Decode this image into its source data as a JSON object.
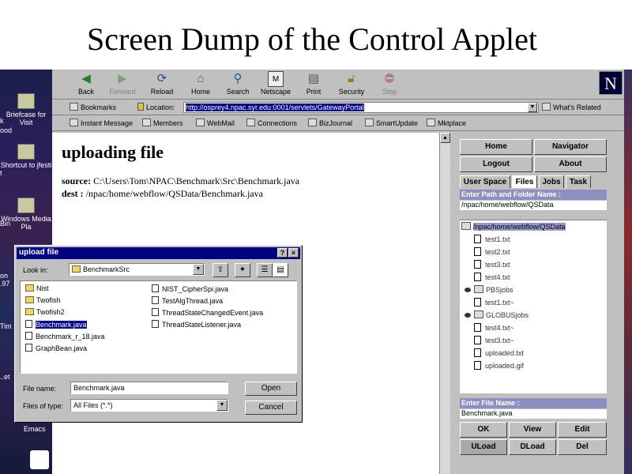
{
  "slide_title": "Screen Dump of the Control Applet",
  "desktop": {
    "icons": [
      "Briefcase for Visit",
      "Shortcut to jfesti",
      "Windows Media Pla",
      "Emacs"
    ],
    "partial_left": [
      "Bin",
      "k",
      "ood",
      "t",
      "on",
      ".97",
      "Tim",
      "..et",
      "Emacs"
    ]
  },
  "toolbar": {
    "back": "Back",
    "forward": "Forward",
    "reload": "Reload",
    "home": "Home",
    "search": "Search",
    "netscape": "Netscape",
    "print": "Print",
    "security": "Security",
    "stop": "Stop"
  },
  "location": {
    "bookmarks": "Bookmarks",
    "label": "Location:",
    "url": "http://osprey4.npac.syr.edu:0001/servlets/GatewayPortal",
    "whats_related": "What's Related"
  },
  "personal": [
    "Instant Message",
    "Members",
    "WebMail",
    "Connections",
    "BizJournal",
    "SmartUpdate",
    "Mktplace"
  ],
  "page": {
    "heading": "uploading file",
    "source_label": "source:",
    "source_path": "C:\\Users\\Tom\\NPAC\\Benchmark\\Src\\Benchmark.java",
    "dest_label": "dest :",
    "dest_path": "/npac/home/webflow/QSData/Benchmark.java"
  },
  "applet": {
    "home": "Home",
    "navigator": "Navigator",
    "logout": "Logout",
    "about": "About",
    "tabs": [
      "User Space",
      "Files",
      "Jobs",
      "Task"
    ],
    "path_label": "Enter Path and Folder Name :",
    "path_value": "/npac/home/webflow/QSData",
    "tree": [
      {
        "name": "/npac/home/webflow/QSData",
        "kind": "root"
      },
      {
        "name": "test1.txt",
        "kind": "file"
      },
      {
        "name": "test2.txt",
        "kind": "file"
      },
      {
        "name": "test3.txt",
        "kind": "file"
      },
      {
        "name": "test4.txt",
        "kind": "file"
      },
      {
        "name": "PBSjobs",
        "kind": "folder"
      },
      {
        "name": "test1.txt~",
        "kind": "file"
      },
      {
        "name": "GLOBUSjobs",
        "kind": "folder"
      },
      {
        "name": "test4.txt~",
        "kind": "file"
      },
      {
        "name": "test3.txt~",
        "kind": "file"
      },
      {
        "name": "uploaded.txt",
        "kind": "file"
      },
      {
        "name": "uploaded.gif",
        "kind": "file"
      }
    ],
    "file_label": "Enter File Name :",
    "file_value": "Benchmark.java",
    "ok": "OK",
    "view": "View",
    "edit": "Edit",
    "uload": "ULoad",
    "dload": "DLoad",
    "del": "Del"
  },
  "dialog": {
    "title": "upload file",
    "help": "?",
    "close": "×",
    "look_in_label": "Look in:",
    "look_in_value": "BenchmarkSrc",
    "files_left": [
      {
        "name": "Nist",
        "kind": "folder"
      },
      {
        "name": "Twofish",
        "kind": "folder"
      },
      {
        "name": "Twofish2",
        "kind": "folder"
      },
      {
        "name": "Benchmark.java",
        "kind": "file"
      },
      {
        "name": "Benchmark_r_18.java",
        "kind": "file"
      },
      {
        "name": "GraphBean.java",
        "kind": "file"
      }
    ],
    "files_right": [
      {
        "name": "NIST_CipherSpi.java",
        "kind": "file"
      },
      {
        "name": "TestAlgThread.java",
        "kind": "file"
      },
      {
        "name": "ThreadStateChangedEvent.java",
        "kind": "file"
      },
      {
        "name": "ThreadStateListener.java",
        "kind": "file"
      }
    ],
    "file_name_label": "File name:",
    "file_name_value": "Benchmark.java",
    "file_type_label": "Files of type:",
    "file_type_value": "All Files (*.*)",
    "open": "Open",
    "cancel": "Cancel"
  }
}
